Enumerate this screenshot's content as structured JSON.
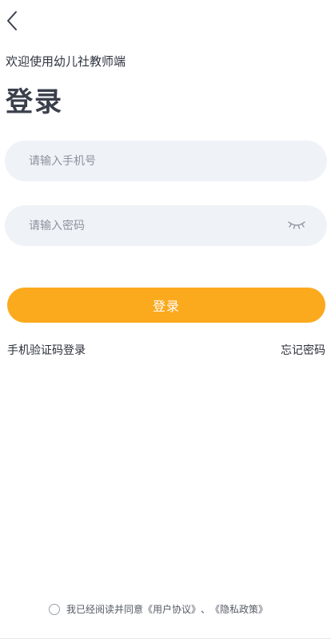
{
  "header": {
    "back_icon": "chevron-left-icon",
    "welcome_text": "欢迎使用幼儿社教师端",
    "title": "登录"
  },
  "form": {
    "phone_placeholder": "请输入手机号",
    "phone_value": "",
    "password_placeholder": "请输入密码",
    "password_value": "",
    "password_toggle_icon": "eye-closed-icon",
    "field_background": "#eff2f7"
  },
  "actions": {
    "login_label": "登录",
    "login_color": "#fbaa1e",
    "sms_login_label": "手机验证码登录",
    "forgot_password_label": "忘记密码"
  },
  "agreement": {
    "checked": false,
    "prefix": "我已经阅读并同意",
    "user_agreement": "《用户协议》",
    "separator": "、",
    "privacy_policy": "《隐私政策》"
  }
}
